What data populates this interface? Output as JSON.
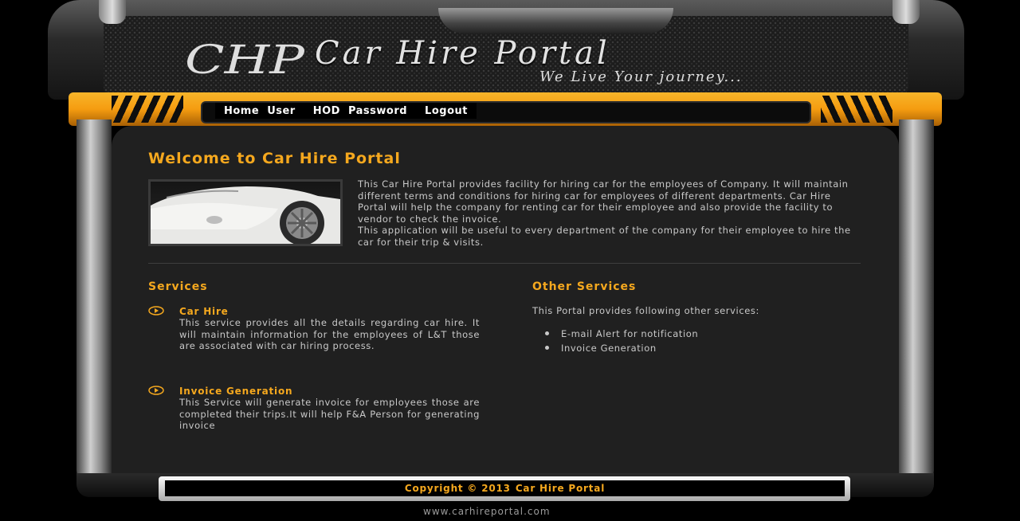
{
  "header": {
    "logo_text": "CHP",
    "title": "Car Hire Portal",
    "tagline": "We Live Your journey..."
  },
  "nav": {
    "items": [
      {
        "label": "Home"
      },
      {
        "label": "User"
      },
      {
        "label": "HOD"
      },
      {
        "label": "Password"
      },
      {
        "label": "Logout"
      }
    ]
  },
  "main": {
    "welcome_title": "Welcome to Car Hire Portal",
    "intro_paragraph_1": "This Car Hire Portal provides facility for hiring car for the employees of Company. It will maintain different terms and conditions for hiring car for employees of different departments. Car Hire Portal will help the company for renting car for their employee and also provide the facility to vendor to check the invoice.",
    "intro_paragraph_2": "This application will be useful to every department of the company for their employee to hire the car for their trip & visits."
  },
  "services": {
    "heading": "Services",
    "items": [
      {
        "title": "Car Hire",
        "description": "This service provides all the details regarding car hire. It will maintain information for the employees of L&T those are associated with car hiring process."
      },
      {
        "title": "Invoice Generation",
        "description": "This Service will generate invoice for employees those are completed their trips.It will help F&A Person for generating invoice"
      }
    ]
  },
  "other_services": {
    "heading": "Other Services",
    "intro": "This Portal provides following other services:",
    "items": [
      {
        "label": "E-mail Alert for notification"
      },
      {
        "label": "Invoice Generation"
      }
    ]
  },
  "footer": {
    "copyright": "Copyright © 2013",
    "brand": "Car Hire Portal",
    "url": "www.carhireportal.com"
  },
  "colors": {
    "accent": "#f5a81e",
    "panel": "#202020",
    "text": "#c9c9c9"
  }
}
